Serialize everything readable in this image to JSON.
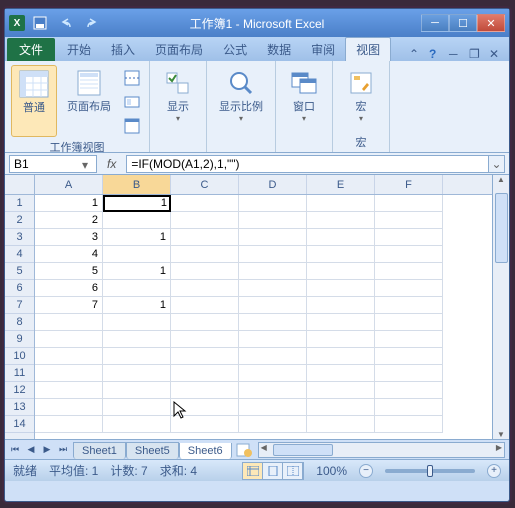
{
  "title": "工作簿1 - Microsoft Excel",
  "tabs": {
    "file": "文件",
    "items": [
      "开始",
      "插入",
      "页面布局",
      "公式",
      "数据",
      "审阅",
      "视图"
    ],
    "active": 6
  },
  "ribbon": {
    "group1_label": "工作簿视图",
    "normal": "普通",
    "page_layout": "页面布局",
    "show": "显示",
    "zoom": "显示比例",
    "window": "窗口",
    "macro": "宏"
  },
  "namebox": "B1",
  "formula": "=IF(MOD(A1,2),1,\"\")",
  "columns": [
    "A",
    "B",
    "C",
    "D",
    "E",
    "F"
  ],
  "rows": [
    "1",
    "2",
    "3",
    "4",
    "5",
    "6",
    "7",
    "8",
    "9",
    "10",
    "11",
    "12",
    "13",
    "14"
  ],
  "chart_data": {
    "type": "table",
    "columns": [
      "A",
      "B"
    ],
    "data": [
      [
        1,
        1
      ],
      [
        2,
        ""
      ],
      [
        3,
        1
      ],
      [
        4,
        ""
      ],
      [
        5,
        1
      ],
      [
        6,
        ""
      ],
      [
        7,
        1
      ]
    ]
  },
  "sheets": [
    "Sheet1",
    "Sheet5",
    "Sheet6"
  ],
  "status": {
    "ready": "就绪",
    "avg": "平均值: 1",
    "count": "计数: 7",
    "sum": "求和: 4",
    "zoom": "100%"
  }
}
